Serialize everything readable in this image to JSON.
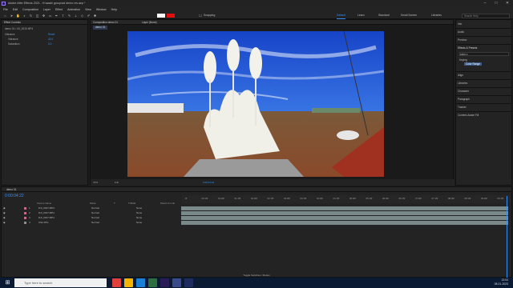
{
  "window": {
    "title": "Adobe After Effects 2021 - H:\\aashi group\\ad demo rev.aep *",
    "controls": [
      "–",
      "□",
      "✕"
    ]
  },
  "menu": [
    "File",
    "Edit",
    "Composition",
    "Layer",
    "Effect",
    "Animation",
    "View",
    "Window",
    "Help"
  ],
  "toolbar": {
    "workspaces": [
      "Default",
      "Learn",
      "Standard",
      "Small Screen",
      "Libraries"
    ],
    "active_workspace": "Default",
    "search_placeholder": "Search Help",
    "snapping": "Snapping"
  },
  "effect_controls": {
    "tab": "Effect Controls",
    "sub": "demo 01 • 00_0015 MP4",
    "props": [
      {
        "name": "Vibrance",
        "value": "Reset"
      },
      {
        "name": "Vibrance",
        "value": "42.0"
      },
      {
        "name": "Saturation",
        "value": "0.0"
      }
    ]
  },
  "composition": {
    "tab": "Composition demo 01",
    "subtab": "demo 01",
    "layer_label": "Layer (None)",
    "zoom": "70%",
    "resolution": "Full",
    "timecode": "0:00:04:24"
  },
  "right_panel": {
    "items": [
      "Info",
      "Audio",
      "Preview",
      "Effects & Presets",
      "Align",
      "Libraries",
      "Character",
      "Paragraph",
      "Tracker",
      "Content-Aware Fill"
    ],
    "effects_search": "color c",
    "effects_group": "Keying",
    "effects_result": "Color Range"
  },
  "timeline": {
    "tab": "demo 01",
    "timecode": "0:00:04:22",
    "columns": [
      "Source Name",
      "Mode",
      "T",
      "TrkMat",
      "Parent & Link"
    ],
    "layers": [
      {
        "num": "1",
        "name": "DJI_0017.MP4",
        "mode": "Normal",
        "parent": "None",
        "color": "#c86a8c"
      },
      {
        "num": "2",
        "name": "DJI_0017.MP4",
        "mode": "Normal",
        "parent": "None",
        "color": "#c86a8c"
      },
      {
        "num": "3",
        "name": "DJI_0017.MP4",
        "mode": "Normal",
        "parent": "None",
        "color": "#c86a8c"
      },
      {
        "num": "4",
        "name": "CS2.JPG",
        "mode": "Normal",
        "parent": "None",
        "color": "#8e8e8e"
      }
    ],
    "ruler": [
      "0f",
      "00:15f",
      "01:00f",
      "01:15f",
      "02:00f",
      "02:15f",
      "03:00f",
      "03:15f",
      "04:00f",
      "04:15f",
      "05:00f",
      "05:15f",
      "06:00f",
      "06:15f",
      "07:00f",
      "07:15f",
      "08:00f",
      "08:15f",
      "09:00f",
      "09:15f"
    ],
    "footer": "Toggle Switches / Modes"
  },
  "taskbar": {
    "search": "Type here to search",
    "time": "13:04",
    "date": "08-01-2023",
    "colors": [
      "#e0403a",
      "#f4b400",
      "#1b7fd6",
      "#2c6e3e",
      "#2a1a55",
      "#3a4a8a",
      "#1d2b5f"
    ]
  }
}
